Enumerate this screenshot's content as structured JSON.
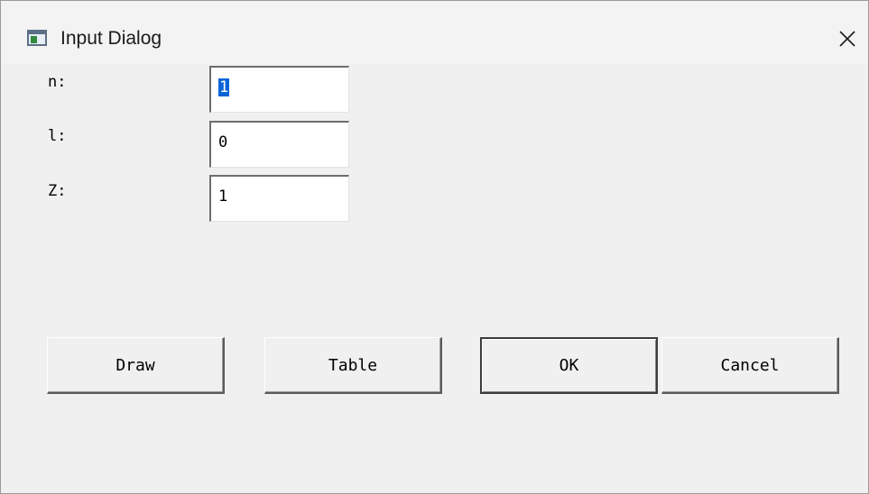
{
  "window": {
    "title": "Input Dialog",
    "icon": "app-window-icon",
    "close_icon": "close-icon"
  },
  "fields": [
    {
      "label": "n:",
      "value": "1",
      "selected": true
    },
    {
      "label": "l:",
      "value": "0",
      "selected": false
    },
    {
      "label": "Z:",
      "value": "1",
      "selected": false
    }
  ],
  "buttons": {
    "draw": "Draw",
    "table": "Table",
    "ok": "OK",
    "cancel": "Cancel"
  },
  "colors": {
    "selection": "#0a64d8",
    "window_bg": "#f0f0f0"
  }
}
